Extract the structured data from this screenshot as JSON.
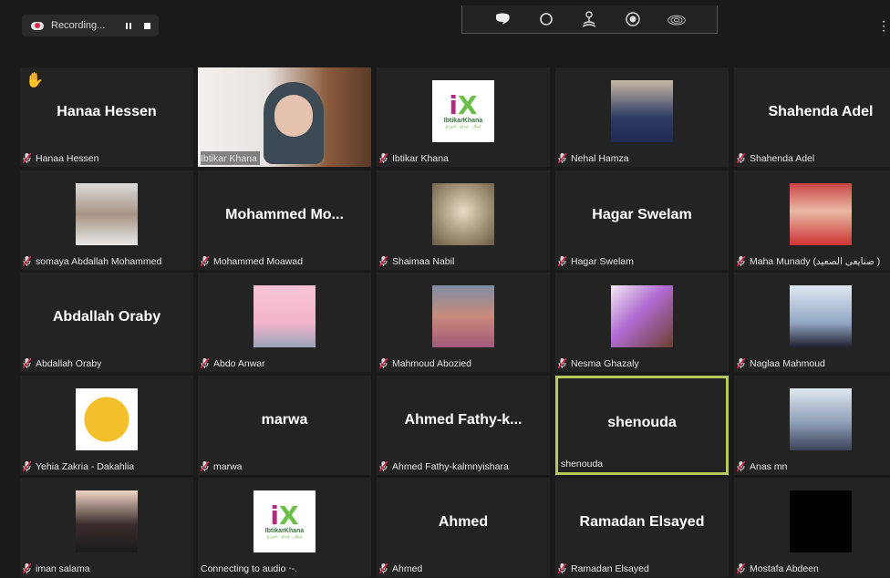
{
  "recording": {
    "label": "Recording..."
  },
  "toolbar": {
    "icons": [
      "chat-icon",
      "circle-icon",
      "podcast-icon",
      "record-icon",
      "signal-icon"
    ]
  },
  "tiles": [
    {
      "display": "Hanaa Hessen",
      "label": "Hanaa Hessen",
      "muted": true,
      "raised_hand": true
    },
    {
      "display": "",
      "label": "Ibtikar Khana",
      "muted": false,
      "video": "teacher"
    },
    {
      "display": "",
      "label": "Ibtikar Khana",
      "muted": true,
      "image": "ibtikar-logo"
    },
    {
      "display": "",
      "label": "Nehal Hamza",
      "muted": true,
      "image": "portrait"
    },
    {
      "display": "Shahenda Adel",
      "label": "Shahenda Adel",
      "muted": true
    },
    {
      "display": "",
      "label": "somaya Abdallah Mohammed",
      "muted": true,
      "image": "baby"
    },
    {
      "display": "Mohammed  Mo...",
      "label": "Mohammed Moawad",
      "muted": true
    },
    {
      "display": "",
      "label": "Shaimaa Nabil",
      "muted": true,
      "image": "sketch"
    },
    {
      "display": "Hagar Swelam",
      "label": "Hagar Swelam",
      "muted": true
    },
    {
      "display": "",
      "label": "Maha Munady (صنايعى الصعيد )",
      "muted": true,
      "image": "portrait-red"
    },
    {
      "display": "Abdallah Oraby",
      "label": "Abdallah Oraby",
      "muted": true
    },
    {
      "display": "",
      "label": "Abdo Anwar",
      "muted": true,
      "image": "man-pink"
    },
    {
      "display": "",
      "label": "Mahmoud Abozied",
      "muted": true,
      "image": "group"
    },
    {
      "display": "",
      "label": "Nesma Ghazaly",
      "muted": true,
      "image": "woman-sun"
    },
    {
      "display": "",
      "label": "Naglaa Mahmoud",
      "muted": true,
      "image": "woman-blue"
    },
    {
      "display": "",
      "label": "Yehia Zakria - Dakahlia",
      "muted": true,
      "image": "man-yellow"
    },
    {
      "display": "marwa",
      "label": "marwa",
      "muted": true
    },
    {
      "display": "Ahmed  Fathy-k...",
      "label": "Ahmed Fathy-kalmnyishara",
      "muted": true
    },
    {
      "display": "shenouda",
      "label": "shenouda",
      "muted": false,
      "active": true
    },
    {
      "display": "",
      "label": "Anas mn",
      "muted": true,
      "image": "snow"
    },
    {
      "display": "",
      "label": "iman salama",
      "muted": true,
      "image": "woman-scarf"
    },
    {
      "display": "",
      "label": "Connecting to audio ⋅-.",
      "muted": false,
      "image": "ibtikar-logo"
    },
    {
      "display": "Ahmed",
      "label": "Ahmed",
      "muted": true
    },
    {
      "display": "Ramadan Elsayed",
      "label": "Ramadan Elsayed",
      "muted": true
    },
    {
      "display": "",
      "label": "Mostafa Abdeen",
      "muted": true,
      "image": "black"
    }
  ],
  "logo": {
    "brand": "IbtikarKhana",
    "sub": "ابتكار · إبداع · اختراع"
  }
}
